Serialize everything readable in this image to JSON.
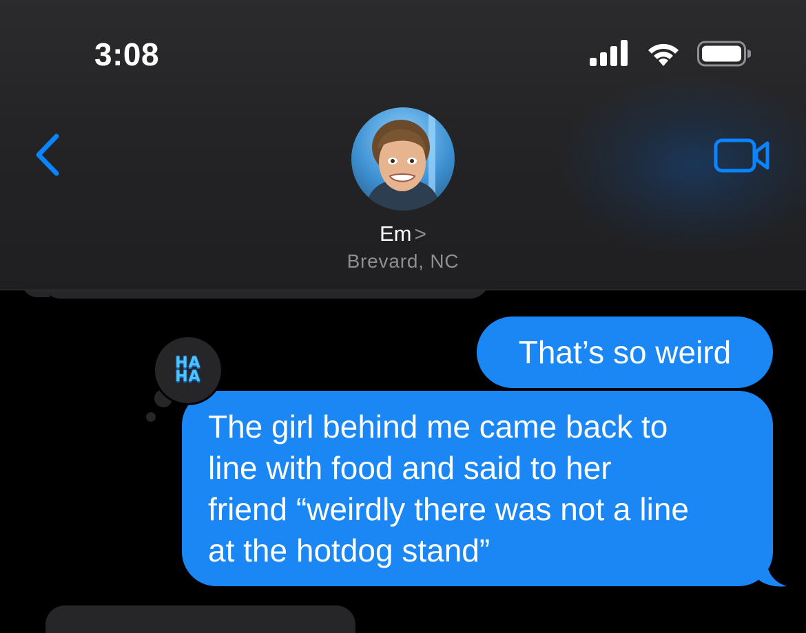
{
  "status_bar": {
    "time": "3:08",
    "icons": [
      "cellular-signal-icon",
      "wifi-icon",
      "battery-icon"
    ]
  },
  "header": {
    "back_icon": "chevron-left-icon",
    "contact_name": "Em",
    "contact_chevron": ">",
    "contact_subtitle": "Brevard, NC",
    "video_icon": "facetime-video-icon",
    "accent_color": "#0a84ff"
  },
  "messages": [
    {
      "type": "received-partial",
      "text": ""
    },
    {
      "type": "sent",
      "text": "That’s so weird"
    },
    {
      "type": "sent",
      "lines": [
        "The girl behind me came back to",
        "line with food and said to her",
        "friend “weirdly there was not a line",
        "at the hotdog stand”"
      ],
      "tapback": {
        "label_line1": "HA",
        "label_line2": "HA",
        "icon": "haha-tapback-icon"
      }
    },
    {
      "type": "received-partial",
      "text": ""
    }
  ],
  "colors": {
    "sent_bubble": "#1a87f5",
    "received_bubble": "#262629",
    "background": "#000000"
  }
}
